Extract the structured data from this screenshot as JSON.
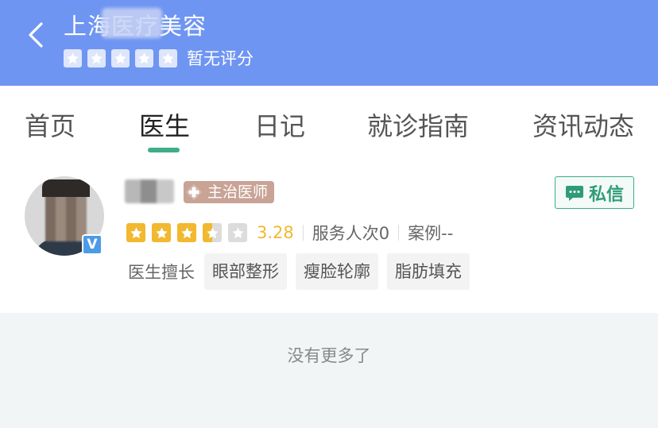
{
  "header": {
    "title": "上海医疗美容",
    "rating_text": "暂无评分",
    "star_count": 5
  },
  "tabs": [
    {
      "label": "首页"
    },
    {
      "label": "医生"
    },
    {
      "label": "日记"
    },
    {
      "label": "就诊指南"
    },
    {
      "label": "资讯动态"
    }
  ],
  "active_tab": 1,
  "doctor": {
    "title_badge": "主治医师",
    "rating": 3.28,
    "rating_text": "3.28",
    "stars_filled": 3.5,
    "service": "服务人次0",
    "cases": "案例--",
    "verified_badge": "V",
    "tags_label": "医生擅长",
    "tags": [
      "眼部整形",
      "瘦脸轮廓",
      "脂肪填充"
    ],
    "message_button": "私信"
  },
  "footer": {
    "no_more": "没有更多了"
  },
  "colors": {
    "header_bg": "#6f95f2",
    "accent_green": "#3dad8a",
    "star_yellow": "#f2b830",
    "badge_bg": "#c9a396"
  }
}
